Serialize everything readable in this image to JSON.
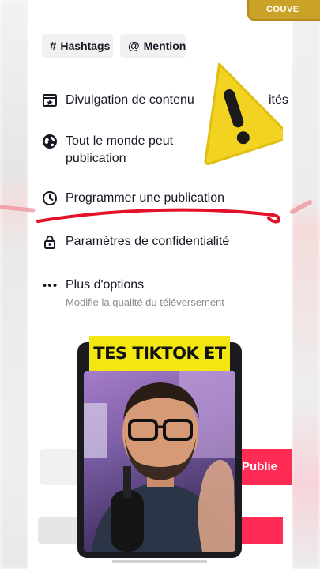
{
  "header": {
    "cover_label": "COUVE"
  },
  "chips": [
    {
      "symbol": "#",
      "label": "Hashtags"
    },
    {
      "symbol": "@",
      "label": "Mention"
    }
  ],
  "settings": [
    {
      "label": "Divulgation de contenu",
      "label_tail": "ités"
    },
    {
      "label_line1": "Tout le monde peut",
      "label_line2": "publication"
    },
    {
      "label": "Programmer une publication"
    },
    {
      "label": "Paramètres de confidentialité"
    },
    {
      "label": "Plus d'options",
      "subtitle": "Modifie la qualité du téléversement"
    }
  ],
  "overlay": {
    "banner_text": "TES TIKTOK ET"
  },
  "actions": {
    "publish_label": "Publie"
  },
  "colors": {
    "accent": "#fe2c55",
    "highlight": "#f3e711",
    "warning": "#f2d321",
    "underline": "#e4102a"
  }
}
